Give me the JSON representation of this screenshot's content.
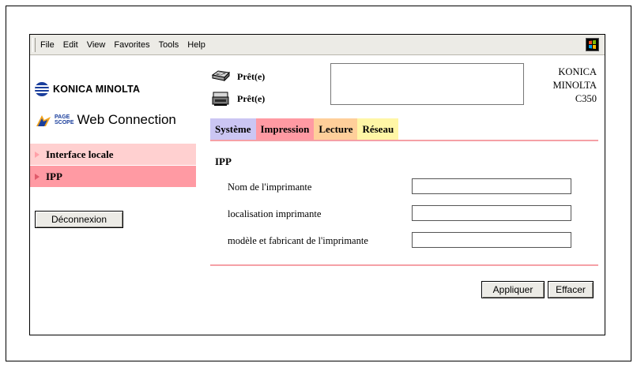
{
  "menubar": {
    "items": [
      "File",
      "Edit",
      "View",
      "Favorites",
      "Tools",
      "Help"
    ]
  },
  "brand": {
    "maker": "KONICA MINOLTA",
    "pagescope_top": "PAGE",
    "pagescope_bottom": "SCOPE",
    "product": "Web Connection"
  },
  "sidebar": {
    "items": [
      {
        "label": "Interface locale",
        "active": false
      },
      {
        "label": "IPP",
        "active": true
      }
    ],
    "logout_label": "Déconnexion"
  },
  "status": {
    "printer_status": "Prêt(e)",
    "scanner_status": "Prêt(e)",
    "model_line1": "KONICA",
    "model_line2": "MINOLTA",
    "model_line3": "C350"
  },
  "tabs": [
    {
      "label": "Système",
      "color": "#cbc6f3"
    },
    {
      "label": "Impression",
      "color": "#ff9aa3"
    },
    {
      "label": "Lecture",
      "color": "#ffcf9a"
    },
    {
      "label": "Réseau",
      "color": "#fff6a6"
    }
  ],
  "form": {
    "section_title": "IPP",
    "fields": [
      {
        "label": "Nom de l'imprimante",
        "value": ""
      },
      {
        "label": "localisation imprimante",
        "value": ""
      },
      {
        "label": "modèle et fabricant de l'imprimante",
        "value": ""
      }
    ],
    "apply_label": "Appliquer",
    "clear_label": "Effacer"
  },
  "icons": {
    "menubar_logo": "windows-flag-icon",
    "printer": "printer-icon",
    "scanner": "scanner-icon",
    "brand": "konica-minolta-globe-icon",
    "nav_arrow": "arrow-right-icon"
  },
  "colors": {
    "brand_blue": "#1a3e9c",
    "nav_active": "#ff9aa3",
    "nav_light": "#ffd0d0",
    "divider": "#f5a0a6"
  }
}
